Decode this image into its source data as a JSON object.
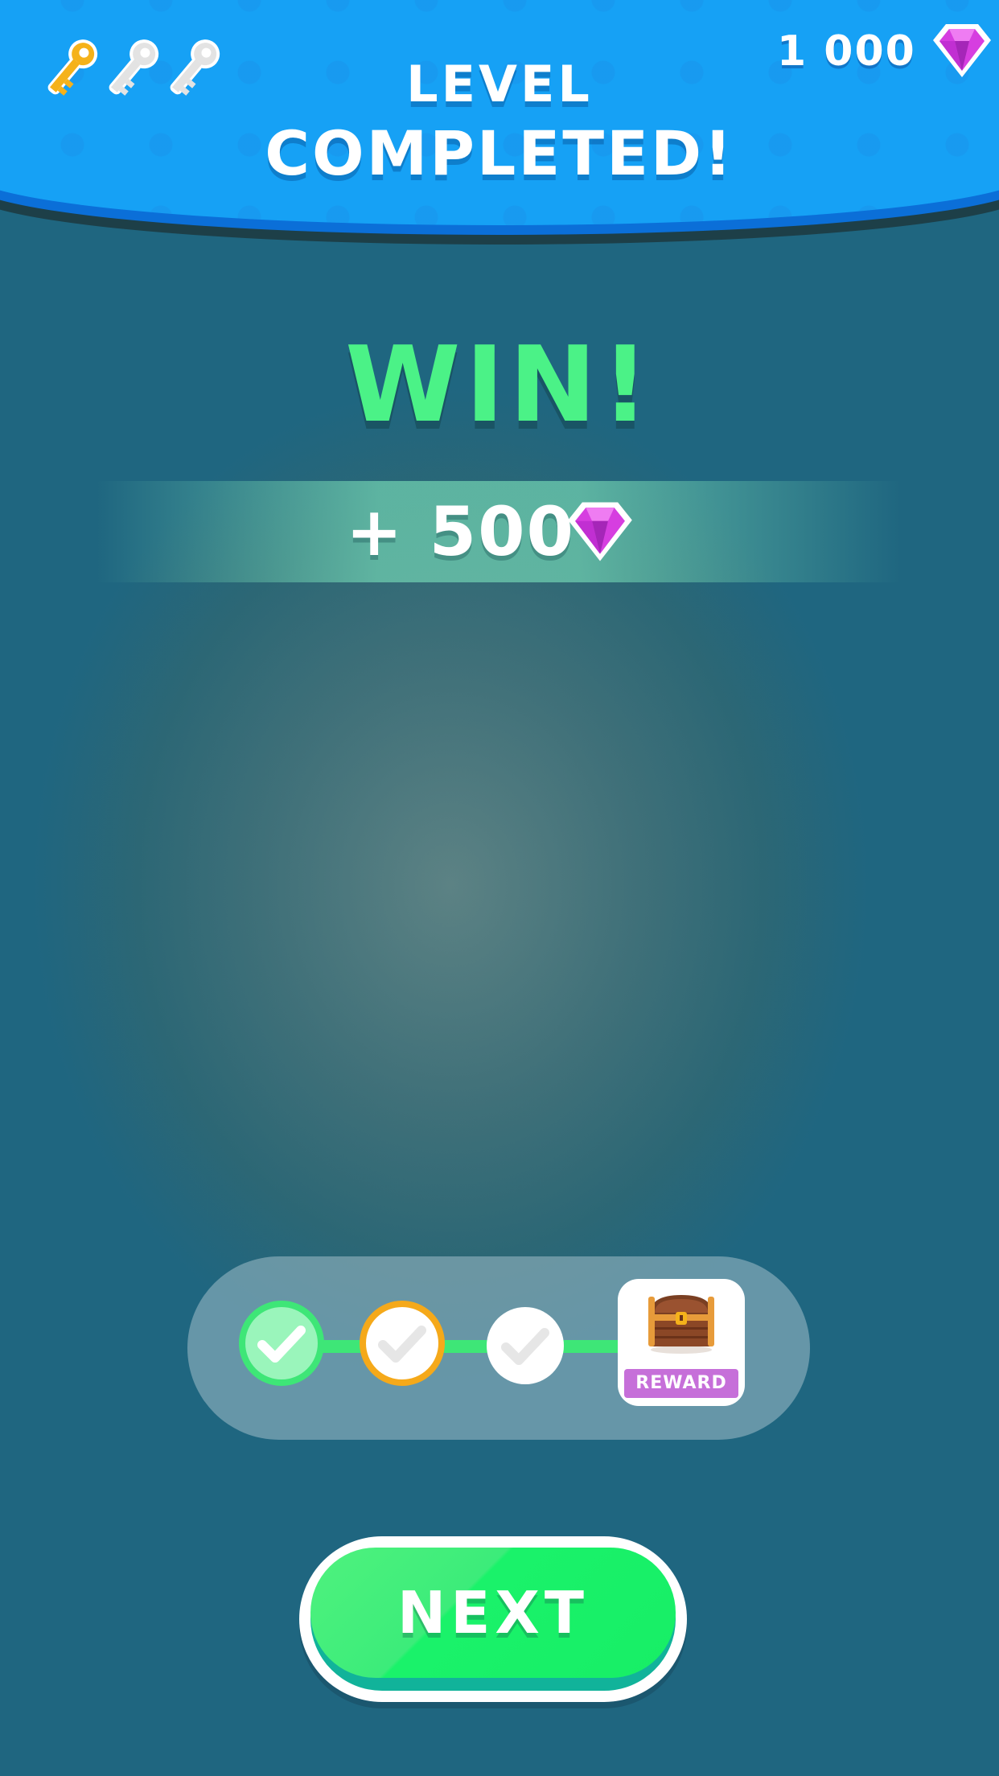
{
  "header": {
    "title_line1": "LEVEL",
    "title_line2": "COMPLETED!",
    "gem_balance": "1 000",
    "keys": [
      {
        "icon": "key-icon",
        "state": "collected",
        "color": "#f5b21a"
      },
      {
        "icon": "key-icon",
        "state": "empty",
        "color": "#e6e6e6"
      },
      {
        "icon": "key-icon",
        "state": "empty",
        "color": "#e6e6e6"
      }
    ],
    "gem_icon": "gem-icon",
    "color": "#16a1f5"
  },
  "result": {
    "win_label": "WIN!",
    "reward_amount": "+ 500",
    "reward_icon": "gem-icon",
    "win_color": "#4bf287"
  },
  "progress": {
    "steps": [
      {
        "icon": "check-icon",
        "state": "completed"
      },
      {
        "icon": "check-icon",
        "state": "current"
      },
      {
        "icon": "check-icon",
        "state": "upcoming"
      }
    ],
    "reward": {
      "icon": "treasure-chest-icon",
      "label": "REWARD"
    }
  },
  "next_button": {
    "label": "NEXT",
    "color": "#1af26a"
  }
}
